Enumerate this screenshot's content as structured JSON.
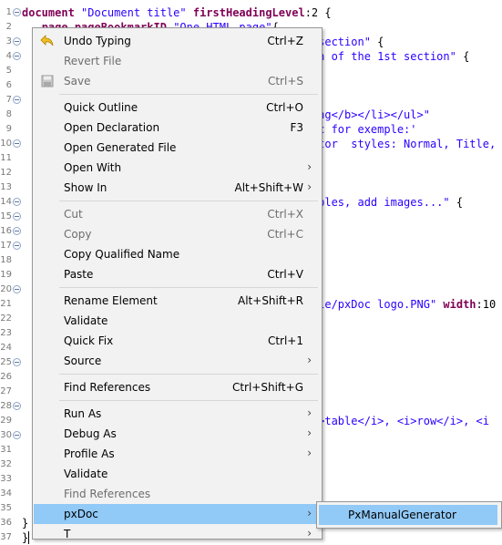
{
  "editor": {
    "lines": [
      {
        "n": "1",
        "fold": true,
        "segs": [
          [
            "kw",
            "document "
          ],
          [
            "str",
            "\"Document title\" "
          ],
          [
            "kw",
            "firstHeadingLevel"
          ],
          [
            "plain",
            ":2 {"
          ]
        ]
      },
      {
        "n": "2",
        "fold": false,
        "segs": [
          [
            "plain",
            "   "
          ],
          [
            "kw",
            "page "
          ],
          [
            "kw",
            "pageBookmarkID "
          ],
          [
            "str",
            "\"One HTML page\""
          ],
          [
            "plain",
            "{"
          ]
        ]
      },
      {
        "n": "3",
        "fold": true,
        "segs": [
          [
            "plain",
            "                                           "
          ],
          [
            "str",
            "t section\""
          ],
          [
            "plain",
            " {"
          ]
        ]
      },
      {
        "n": "4",
        "fold": true,
        "segs": [
          [
            "plain",
            "                                           "
          ],
          [
            "str",
            "ion of the 1st section\""
          ],
          [
            "plain",
            " {"
          ]
        ]
      },
      {
        "n": "5",
        "fold": false,
        "segs": []
      },
      {
        "n": "6",
        "fold": false,
        "segs": []
      },
      {
        "n": "7",
        "fold": true,
        "segs": [
          [
            "plain",
            "                                           "
          ],
          [
            "str",
            ">"
          ]
        ]
      },
      {
        "n": "8",
        "fold": false,
        "segs": [
          [
            "plain",
            "                                           "
          ],
          [
            "str",
            "ting</b></li></ul>\""
          ]
        ]
      },
      {
        "n": "9",
        "fold": false,
        "segs": [
          [
            "plain",
            "                                           "
          ],
          [
            "str",
            "doc for exemple:'"
          ]
        ]
      },
      {
        "n": "10",
        "fold": true,
        "segs": [
          [
            "plain",
            "                                           "
          ],
          [
            "str",
            "rator  styles: Normal, Title,"
          ]
        ]
      },
      {
        "n": "11",
        "fold": false,
        "segs": []
      },
      {
        "n": "12",
        "fold": false,
        "segs": []
      },
      {
        "n": "13",
        "fold": false,
        "segs": []
      },
      {
        "n": "14",
        "fold": true,
        "segs": [
          [
            "plain",
            "                                           "
          ],
          [
            "str",
            "tables, add images...\""
          ],
          [
            "plain",
            " {"
          ]
        ]
      },
      {
        "n": "15",
        "fold": true,
        "segs": []
      },
      {
        "n": "16",
        "fold": true,
        "segs": []
      },
      {
        "n": "17",
        "fold": true,
        "segs": []
      },
      {
        "n": "18",
        "fold": false,
        "segs": []
      },
      {
        "n": "19",
        "fold": false,
        "segs": []
      },
      {
        "n": "20",
        "fold": true,
        "segs": []
      },
      {
        "n": "21",
        "fold": false,
        "segs": [
          [
            "plain",
            "                                           "
          ],
          [
            "str",
            "itle/pxDoc logo.PNG\" "
          ],
          [
            "kw",
            "width"
          ],
          [
            "plain",
            ":10"
          ]
        ]
      },
      {
        "n": "22",
        "fold": false,
        "segs": []
      },
      {
        "n": "23",
        "fold": false,
        "segs": []
      },
      {
        "n": "24",
        "fold": false,
        "segs": []
      },
      {
        "n": "25",
        "fold": true,
        "segs": []
      },
      {
        "n": "26",
        "fold": false,
        "segs": []
      },
      {
        "n": "27",
        "fold": false,
        "segs": []
      },
      {
        "n": "28",
        "fold": true,
        "segs": []
      },
      {
        "n": "29",
        "fold": false,
        "segs": [
          [
            "plain",
            "                                           "
          ],
          [
            "str",
            "<i>table</i>, <i>row</i>, <i"
          ]
        ]
      },
      {
        "n": "30",
        "fold": true,
        "segs": []
      },
      {
        "n": "31",
        "fold": false,
        "segs": []
      },
      {
        "n": "32",
        "fold": false,
        "segs": []
      },
      {
        "n": "33",
        "fold": false,
        "segs": []
      },
      {
        "n": "34",
        "fold": false,
        "segs": []
      },
      {
        "n": "35",
        "fold": false,
        "segs": []
      },
      {
        "n": "36",
        "fold": false,
        "segs": [
          [
            "plain",
            "}"
          ]
        ]
      },
      {
        "n": "37",
        "fold": false,
        "segs": [
          [
            "plain",
            "}"
          ]
        ]
      }
    ]
  },
  "menu": {
    "items": [
      {
        "type": "item",
        "label": "Undo Typing",
        "accel": "Ctrl+Z",
        "disabled": false,
        "submenu": false,
        "icon": "undo-arrow-icon"
      },
      {
        "type": "item",
        "label": "Revert File",
        "accel": "",
        "disabled": true,
        "submenu": false
      },
      {
        "type": "item",
        "label": "Save",
        "accel": "Ctrl+S",
        "disabled": true,
        "submenu": false,
        "icon": "save-disk-icon"
      },
      {
        "type": "sep"
      },
      {
        "type": "item",
        "label": "Quick Outline",
        "accel": "Ctrl+O",
        "disabled": false,
        "submenu": false
      },
      {
        "type": "item",
        "label": "Open Declaration",
        "accel": "F3",
        "disabled": false,
        "submenu": false
      },
      {
        "type": "item",
        "label": "Open Generated File",
        "accel": "",
        "disabled": false,
        "submenu": false
      },
      {
        "type": "item",
        "label": "Open With",
        "accel": "",
        "disabled": false,
        "submenu": true
      },
      {
        "type": "item",
        "label": "Show In",
        "accel": "Alt+Shift+W",
        "disabled": false,
        "submenu": true
      },
      {
        "type": "sep"
      },
      {
        "type": "item",
        "label": "Cut",
        "accel": "Ctrl+X",
        "disabled": true,
        "submenu": false
      },
      {
        "type": "item",
        "label": "Copy",
        "accel": "Ctrl+C",
        "disabled": true,
        "submenu": false
      },
      {
        "type": "item",
        "label": "Copy Qualified Name",
        "accel": "",
        "disabled": false,
        "submenu": false
      },
      {
        "type": "item",
        "label": "Paste",
        "accel": "Ctrl+V",
        "disabled": false,
        "submenu": false
      },
      {
        "type": "sep"
      },
      {
        "type": "item",
        "label": "Rename Element",
        "accel": "Alt+Shift+R",
        "disabled": false,
        "submenu": false
      },
      {
        "type": "item",
        "label": "Validate",
        "accel": "",
        "disabled": false,
        "submenu": false
      },
      {
        "type": "item",
        "label": "Quick Fix",
        "accel": "Ctrl+1",
        "disabled": false,
        "submenu": false
      },
      {
        "type": "item",
        "label": "Source",
        "accel": "",
        "disabled": false,
        "submenu": true
      },
      {
        "type": "sep"
      },
      {
        "type": "item",
        "label": "Find References",
        "accel": "Ctrl+Shift+G",
        "disabled": false,
        "submenu": false
      },
      {
        "type": "sep"
      },
      {
        "type": "item",
        "label": "Run As",
        "accel": "",
        "disabled": false,
        "submenu": true
      },
      {
        "type": "item",
        "label": "Debug As",
        "accel": "",
        "disabled": false,
        "submenu": true
      },
      {
        "type": "item",
        "label": "Profile As",
        "accel": "",
        "disabled": false,
        "submenu": true
      },
      {
        "type": "item",
        "label": "Validate",
        "accel": "",
        "disabled": false,
        "submenu": false
      },
      {
        "type": "item",
        "label": "Find References",
        "accel": "",
        "disabled": true,
        "submenu": false
      },
      {
        "type": "item",
        "label": "pxDoc",
        "accel": "",
        "disabled": false,
        "submenu": true,
        "selected": true
      },
      {
        "type": "item",
        "label": "T",
        "accel": "",
        "disabled": false,
        "submenu": true
      }
    ]
  },
  "submenu": {
    "items": [
      {
        "label": "PxManualGenerator",
        "selected": true
      }
    ]
  },
  "colors": {
    "menu_bg": "#f2f2f2",
    "selection": "#91c9f7",
    "keyword": "#7f0055",
    "string": "#2a00ff"
  }
}
